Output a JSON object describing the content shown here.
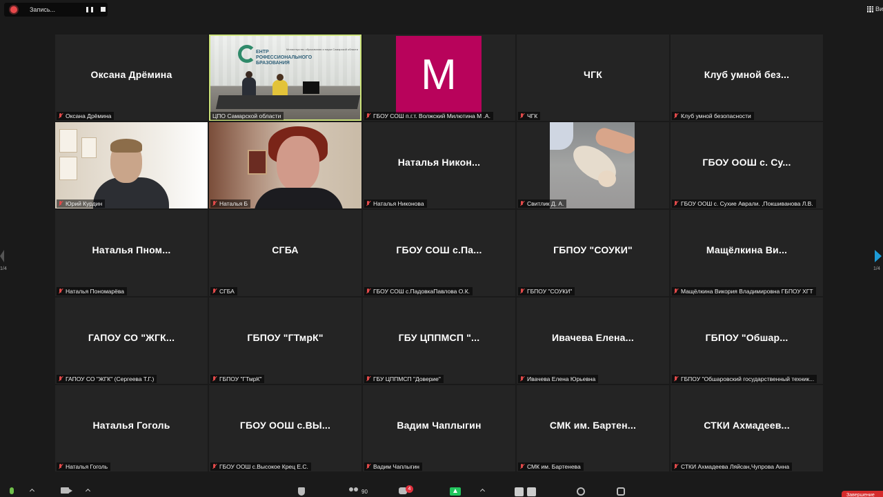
{
  "recording": {
    "label": "Запись..."
  },
  "view": {
    "label": "Ви"
  },
  "pagination": {
    "left": "1/4",
    "right": "1/4"
  },
  "tiles": [
    {
      "name": "Оксана Дрёмина",
      "label": "Оксана Дрёмина"
    },
    {
      "name": "",
      "label": "ЦПО Самарской области",
      "video": "studio",
      "active": true
    },
    {
      "name": "",
      "label": "ГБОУ СОШ п.г.т. Волжский Милютина М .А.",
      "avatar": "M"
    },
    {
      "name": "ЧГК",
      "label": "ЧГК"
    },
    {
      "name": "Клуб умной без...",
      "label": "Клуб умной безопасности"
    },
    {
      "name": "",
      "label": "Юрий Курдин",
      "video": "man"
    },
    {
      "name": "",
      "label": "Наталья Б",
      "video": "woman"
    },
    {
      "name": "Наталья Никон...",
      "label": "Наталья Никонова"
    },
    {
      "name": "",
      "label": "Свитлик Д. А.",
      "video": "cat"
    },
    {
      "name": "ГБОУ ООШ с. Су...",
      "label": "ГБОУ ООШ с. Сухие Аврали. ,Покшиванова Л.В."
    },
    {
      "name": "Наталья Пном...",
      "label": "Наталья Пономарёва"
    },
    {
      "name": "СГБА",
      "label": "СГБА"
    },
    {
      "name": "ГБОУ СОШ с.Па...",
      "label": "ГБОУ СОШ с.ПадовкаПавлова О.К."
    },
    {
      "name": "ГБПОУ \"СОУКИ\"",
      "label": "ГБПОУ \"СОУКИ\""
    },
    {
      "name": "Мащёлкина Ви...",
      "label": "Мащёлкина Викория Владимировна ГБПОУ ХГТ"
    },
    {
      "name": "ГАПОУ СО \"ЖГК...",
      "label": "ГАПОУ СО \"ЖГК\" (Сергеева Т.Г.)"
    },
    {
      "name": "ГБПОУ \"ГТмрК\"",
      "label": "ГБПОУ \"ГТмрК\""
    },
    {
      "name": "ГБУ ЦППМСП \"...",
      "label": "ГБУ ЦППМСП \"Доверие\""
    },
    {
      "name": "Ивачева Елена...",
      "label": "Ивачева Елена Юрьевна"
    },
    {
      "name": "ГБПОУ \"Обшар...",
      "label": "ГБПОУ \"Обшаровский государственный техник..."
    },
    {
      "name": "Наталья Гоголь",
      "label": "Наталья Гоголь"
    },
    {
      "name": "ГБОУ ООШ с.ВЫ...",
      "label": "ГБОУ ООШ с.Высокое Крец Е.С."
    },
    {
      "name": "Вадим Чаплыгин",
      "label": "Вадим Чаплыгин"
    },
    {
      "name": "СМК им. Бартен...",
      "label": "СМК им. Бартенева"
    },
    {
      "name": "СТКИ Ахмадеев...",
      "label": "СТКИ Ахмадеева Ляйсан,Чупрова Анна"
    }
  ],
  "studio": {
    "title_line1": "ЕНТР",
    "title_line2": "РОФЕССИОНАЛЬНОГО",
    "title_line3": "БРАЗОВАНИЯ",
    "small": "Министерство образования и науки Самарской области"
  },
  "toolbar": {
    "participants_count": "90",
    "chat_badge": "4",
    "end_label": "Завершение"
  }
}
